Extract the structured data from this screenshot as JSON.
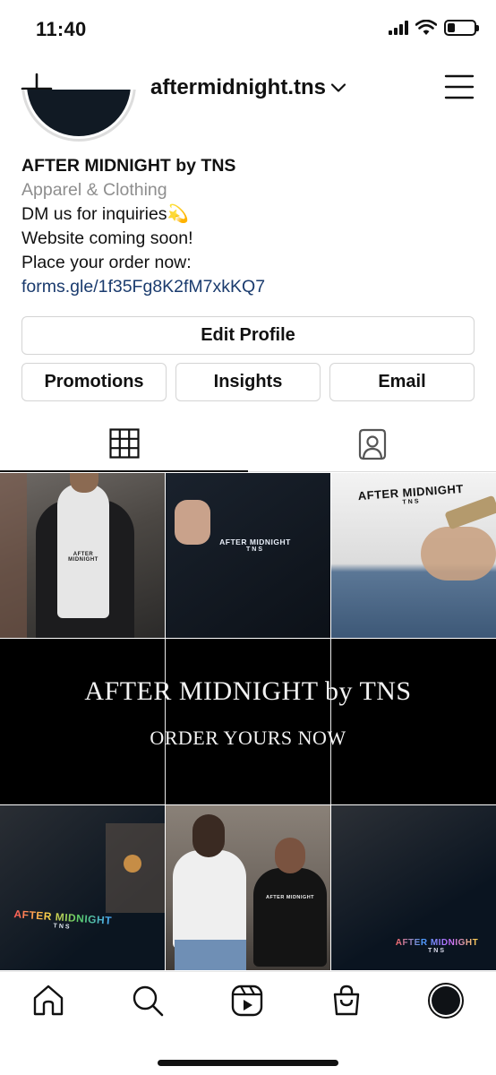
{
  "status_bar": {
    "time": "11:40"
  },
  "header": {
    "username": "aftermidnight.tns"
  },
  "profile": {
    "name": "AFTER MIDNIGHT by TNS",
    "category": "Apparel & Clothing",
    "bio_line1": "DM us for inquiries💫",
    "bio_line2": "Website coming soon!",
    "bio_line3": "Place your order now:",
    "link": "forms.gle/1f35Fg8K2fM7xkKQ7"
  },
  "buttons": {
    "edit_profile": "Edit Profile",
    "promotions": "Promotions",
    "insights": "Insights",
    "email": "Email"
  },
  "grid": {
    "post1_print": "AFTER MIDNIGHT",
    "post2_print": "AFTER MIDNIGHT",
    "post2_sub": "TNS",
    "post3_print": "AFTER MIDNIGHT",
    "post3_sub": "TNS",
    "banner_title": "AFTER MIDNIGHT by TNS",
    "banner_subtitle": "ORDER YOURS NOW",
    "post7_print": "AFTER MIDNIGHT",
    "post7_sub": "TNS",
    "post8_print": "AFTER MIDNIGHT",
    "post9_print": "AFTER MIDNIGHT",
    "post9_sub": "TNS"
  },
  "icons": {
    "new_post": "plus-icon",
    "menu": "hamburger-menu-icon",
    "grid_tab": "grid-icon",
    "tagged_tab": "tagged-person-icon",
    "nav": [
      "home-icon",
      "search-icon",
      "reels-icon",
      "shop-icon",
      "profile-avatar"
    ]
  },
  "colors": {
    "link": "#1a3b6e",
    "category": "#8e8e8e"
  }
}
